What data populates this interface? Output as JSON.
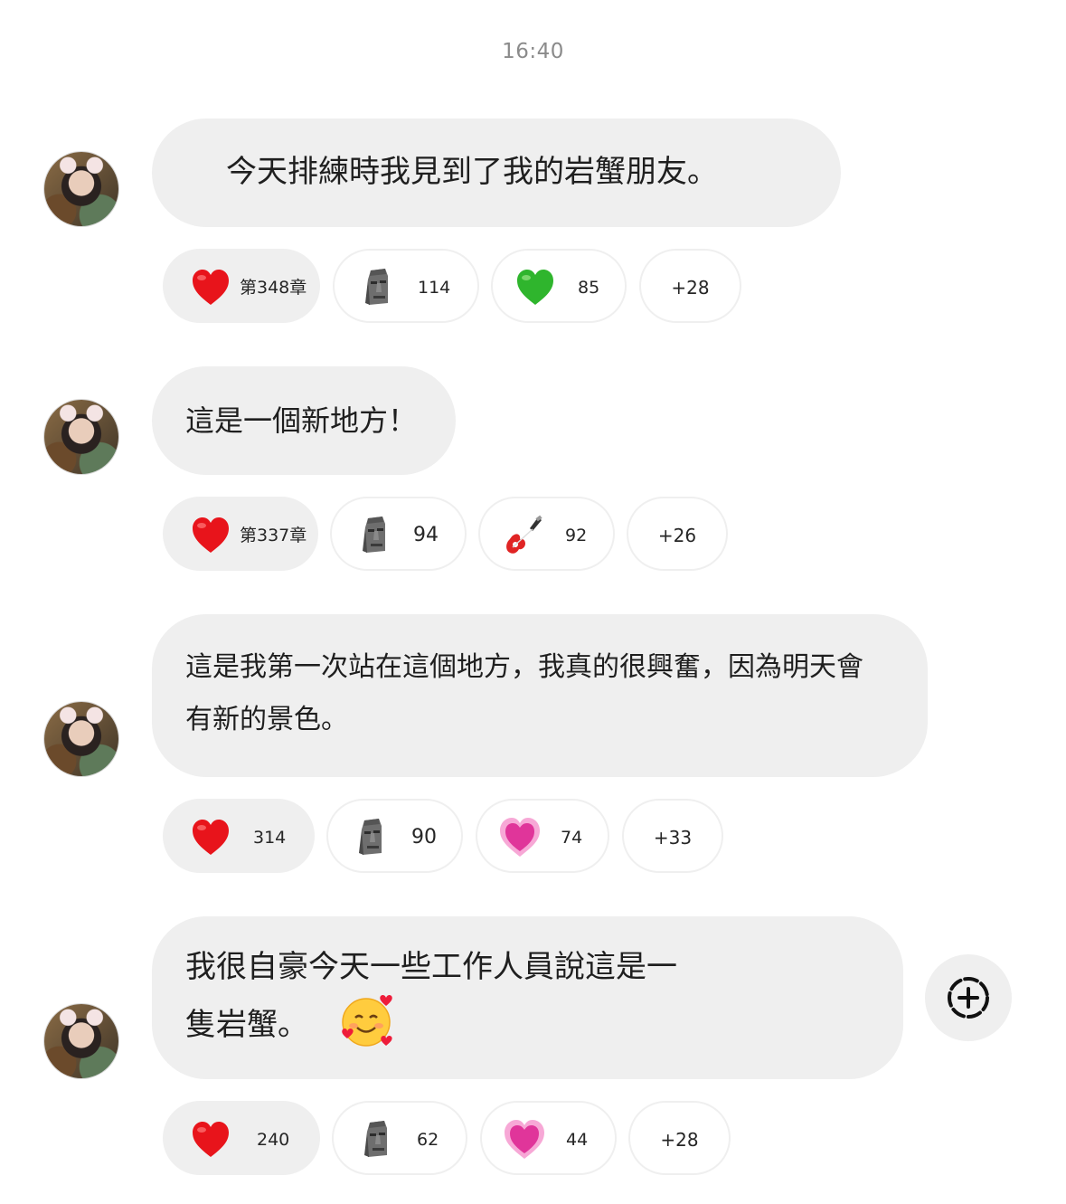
{
  "timestamp": "16:40",
  "messages": [
    {
      "text": "今天排練時我見到了我的岩蟹朋友。",
      "reactions": [
        {
          "emoji": "red-heart",
          "count": "第348章"
        },
        {
          "emoji": "moai",
          "count": "114"
        },
        {
          "emoji": "green-heart",
          "count": "85"
        }
      ],
      "more": "+28"
    },
    {
      "text": "這是一個新地方！",
      "reactions": [
        {
          "emoji": "red-heart",
          "count": "第337章"
        },
        {
          "emoji": "moai",
          "count": "94"
        },
        {
          "emoji": "guitar",
          "count": "92"
        }
      ],
      "more": "+26"
    },
    {
      "text_line1": "這是我第一次站在這個地方，我真的很興奮，因為明天會",
      "text_line2": "有新的景色。",
      "reactions": [
        {
          "emoji": "red-heart",
          "count": "314"
        },
        {
          "emoji": "moai",
          "count": "90"
        },
        {
          "emoji": "growing-pink-heart",
          "count": "74"
        }
      ],
      "more": "+33"
    },
    {
      "text_line1": "我很自豪今天一些工作人員說這是一",
      "text_line2": "隻岩蟹。",
      "inline_emoji": "smiling-face-with-hearts",
      "reactions": [
        {
          "emoji": "red-heart",
          "count": "240"
        },
        {
          "emoji": "moai",
          "count": "62"
        },
        {
          "emoji": "growing-pink-heart",
          "count": "44"
        }
      ],
      "more": "+28"
    }
  ],
  "add_reaction_icon": "add-reaction-icon"
}
